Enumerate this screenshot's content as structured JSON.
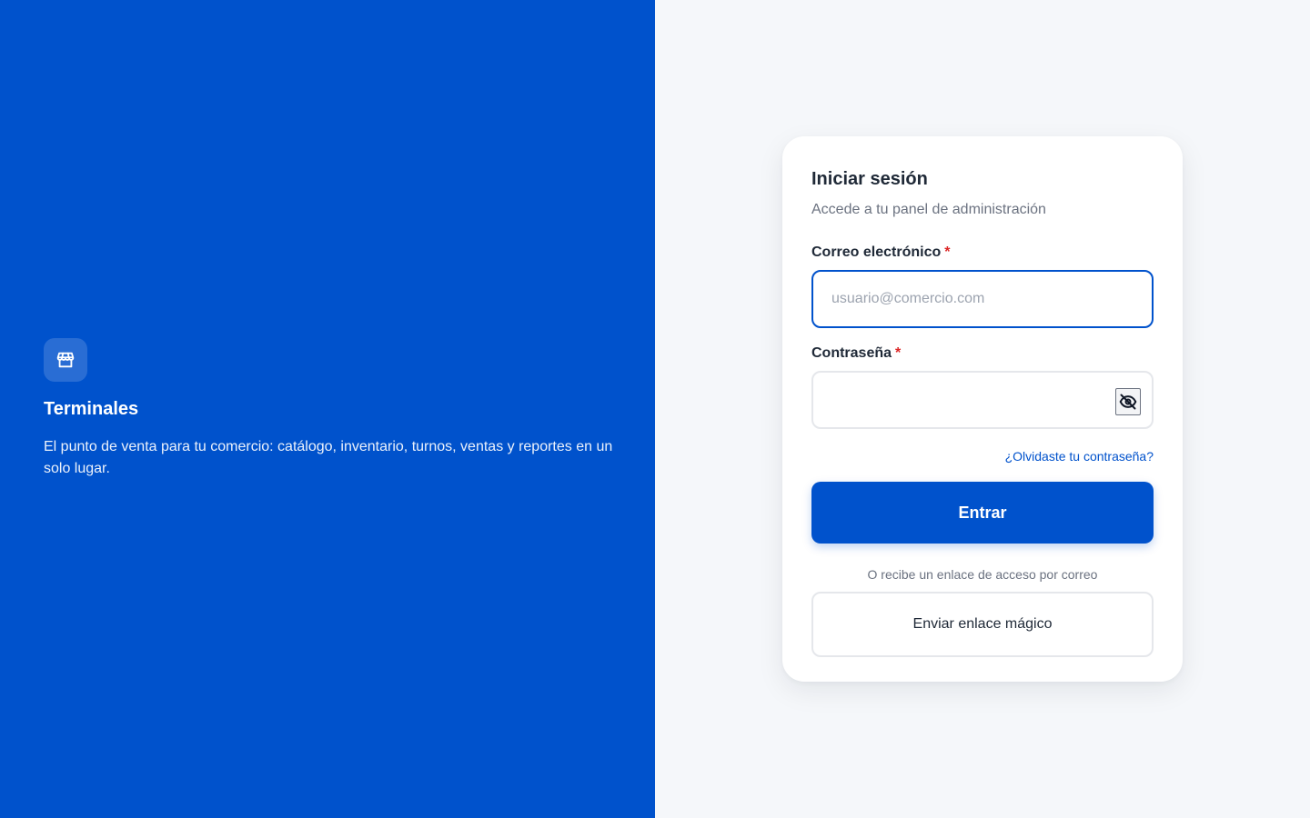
{
  "brand": {
    "icon": "store-icon",
    "title": "Terminales",
    "description": "El punto de venta para tu comercio: catálogo, inventario, turnos, ventas y reportes en un solo lugar."
  },
  "login": {
    "title": "Iniciar sesión",
    "subtitle": "Accede a tu panel de administración",
    "email": {
      "label": "Correo electrónico",
      "required_mark": "*",
      "placeholder": "usuario@comercio.com",
      "value": ""
    },
    "password": {
      "label": "Contraseña",
      "required_mark": "*",
      "value": "",
      "toggle_icon": "eye-off-icon"
    },
    "forgot_link": "¿Olvidaste tu contraseña?",
    "submit_label": "Entrar",
    "alt_text": "O recibe un enlace de acceso por correo",
    "magic_link_label": "Enviar enlace mágico"
  },
  "colors": {
    "primary": "#0052cc",
    "background": "#f5f7fa",
    "required": "#dc2626"
  }
}
